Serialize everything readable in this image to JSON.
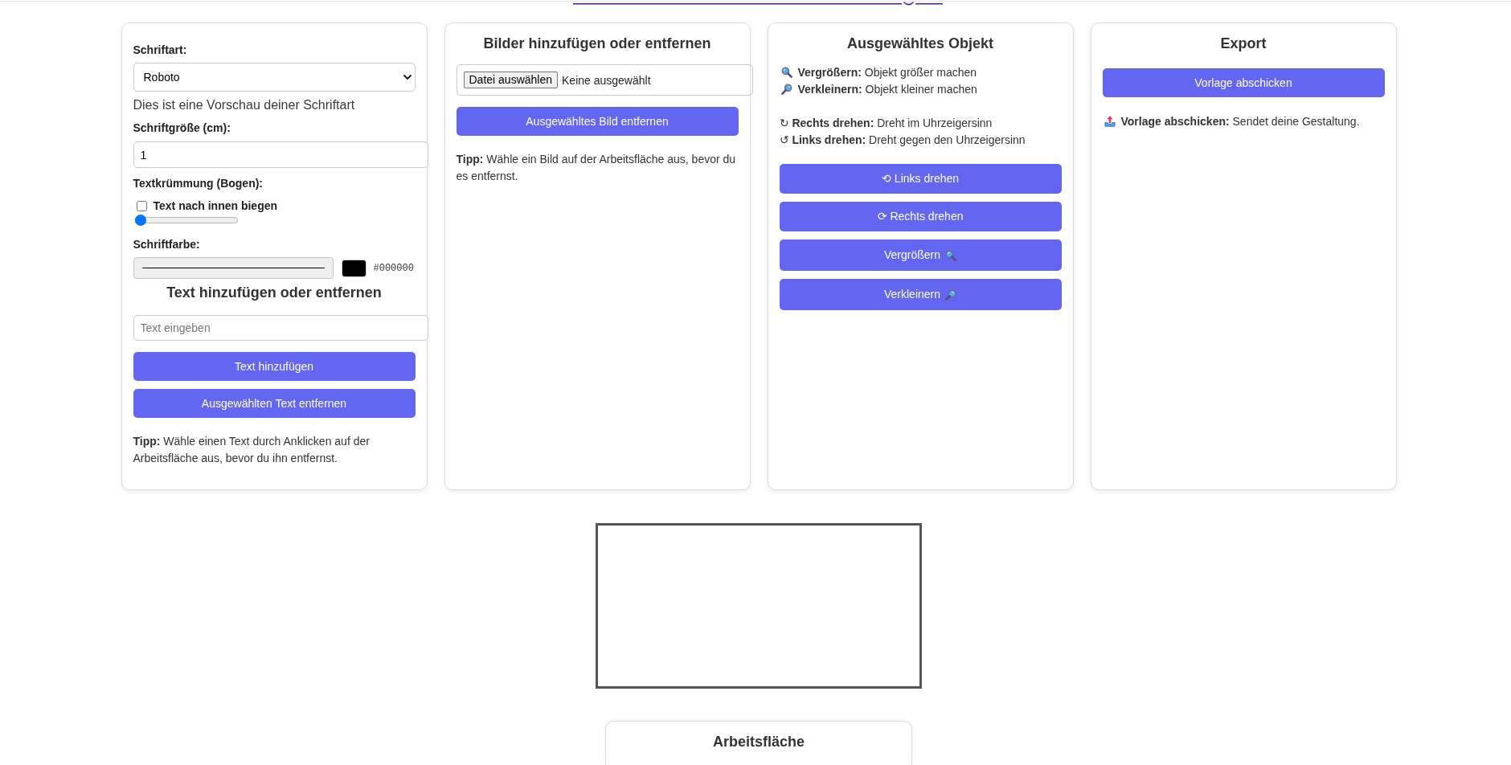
{
  "text_panel": {
    "font_label": "Schriftart:",
    "font_select": {
      "value": "Roboto"
    },
    "font_preview": "Dies ist eine Vorschau deiner Schriftart",
    "size_label": "Schriftgröße (cm):",
    "size_input": {
      "value": "1"
    },
    "curve_label": "Textkrümmung (Bogen):",
    "curve_checkbox": {
      "label": "Text nach innen biegen",
      "checked": false
    },
    "curve_slider": {
      "level": 0
    },
    "color_label": "Schriftfarbe:",
    "color_picker": {
      "color": "#000000",
      "value": "#000000"
    },
    "heading": "Text hinzufügen oder entfernen",
    "text_input": {
      "placeholder": "Text eingeben"
    },
    "buttons": [
      {
        "label": "Text hinzufügen"
      },
      {
        "label": "Ausgewählten Text entfernen"
      }
    ],
    "tip": "**Tipp:** Wähle einen Text durch Anklicken auf der Arbeitsfläche aus, bevor du ihn entfernst."
  },
  "image_panel": {
    "heading": "Bilder hinzufügen oder entfernen",
    "file_input": {
      "button": "Datei auswählen",
      "status": "Keine ausgewählt"
    },
    "buttons": [
      {
        "label": "Ausgewähltes Bild entfernen"
      }
    ],
    "tip": "**Tipp:** Wähle ein Bild auf der Arbeitsfläche aus, bevor du es entfernst."
  },
  "object_panel": {
    "heading": "Ausgewähltes Objekt",
    "legend_groups": [
      [
        {
          "kind": "enlarge",
          "text": "**Vergrößern:** Objekt größer machen"
        },
        {
          "kind": "shrink",
          "text": "**Verkleinern:** Objekt kleiner machen"
        }
      ],
      [
        {
          "kind": "rotate",
          "text": "↻ **Rechts drehen:** Dreht im Uhrzeigersinn"
        },
        {
          "kind": "rotate",
          "text": "↺ **Links drehen:** Dreht gegen den Uhrzeigersinn"
        }
      ]
    ],
    "buttons": [
      {
        "kind": "rotate",
        "label": "⟲ Links drehen"
      },
      {
        "kind": "rotate",
        "label": "⟳ Rechts drehen"
      },
      {
        "kind": "enlarge",
        "label": "Vergrößern"
      },
      {
        "kind": "shrink",
        "label": "Verkleinern"
      }
    ]
  },
  "export_panel": {
    "heading": "Export",
    "buttons": [
      {
        "label": "Vorlage abschicken"
      }
    ],
    "legend_groups": [
      [
        {
          "kind": "submit",
          "text": "**Vorlage abschicken:** Sendet deine Gestaltung."
        }
      ]
    ]
  },
  "workspace_panel": {
    "heading": "Arbeitsfläche"
  }
}
